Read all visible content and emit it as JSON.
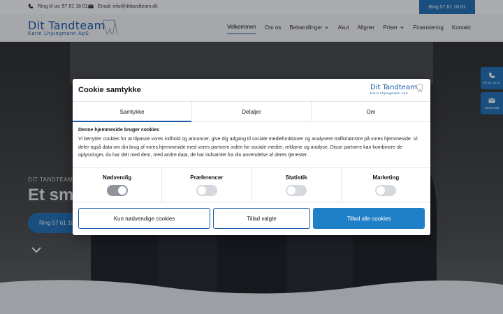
{
  "topbar": {
    "phone_label": "Ring til os: 57 61 18 01",
    "email_label": "Email: info@dittandteam.dk",
    "call_button": "Ring 57 61 18 01"
  },
  "brand": {
    "name": "Dit Tandteam",
    "subtitle": "Karin Lhjungmann ApS"
  },
  "nav": {
    "items": [
      {
        "label": "Velkommen",
        "dropdown": false
      },
      {
        "label": "Om os",
        "dropdown": false
      },
      {
        "label": "Behandlinger",
        "dropdown": true
      },
      {
        "label": "Akut",
        "dropdown": false
      },
      {
        "label": "Aligner",
        "dropdown": false
      },
      {
        "label": "Priser",
        "dropdown": true
      },
      {
        "label": "Finansiering",
        "dropdown": false
      },
      {
        "label": "Kontakt",
        "dropdown": false
      }
    ]
  },
  "hero": {
    "kicker": "DIT TANDTEAM",
    "title": "Et sm",
    "button": "Ring 57 61 18"
  },
  "side_tabs": {
    "phone": "57 61 18 01",
    "mail": "Send mail"
  },
  "cookie_dialog": {
    "title": "Cookie samtykke",
    "tabs": [
      "Samtykke",
      "Detaljer",
      "Om"
    ],
    "active_tab": "Samtykke",
    "heading": "Denne hjemmeside bruger cookies",
    "body": "Vi benytter cookies for at tilpasse vores indhold og annoncer, give dig adgang til sociale mediefunktioner og analysere trafikmønstre på vores hjemmeside. Vi deler også data om din brug af vores hjemmeside med vores partnere inden for sociale medier, reklame og analyse. Disse partnere kan kombinere de oplysninger, du har delt med dem, med andre data, de har indsamlet fra din anvendelse af deres tjenester.",
    "categories": [
      {
        "label": "Nødvendig",
        "enabled": true
      },
      {
        "label": "Præferencer",
        "enabled": false
      },
      {
        "label": "Statistik",
        "enabled": false
      },
      {
        "label": "Marketing",
        "enabled": false
      }
    ],
    "buttons": {
      "necessary_only": "Kun nødvendige cookies",
      "allow_selected": "Tillad valgte",
      "allow_all": "Tillad alle cookies"
    }
  },
  "colors": {
    "brand_blue": "#1a5aa3",
    "button_blue": "#1f6fb5",
    "allow_all_blue": "#1f80c8"
  }
}
